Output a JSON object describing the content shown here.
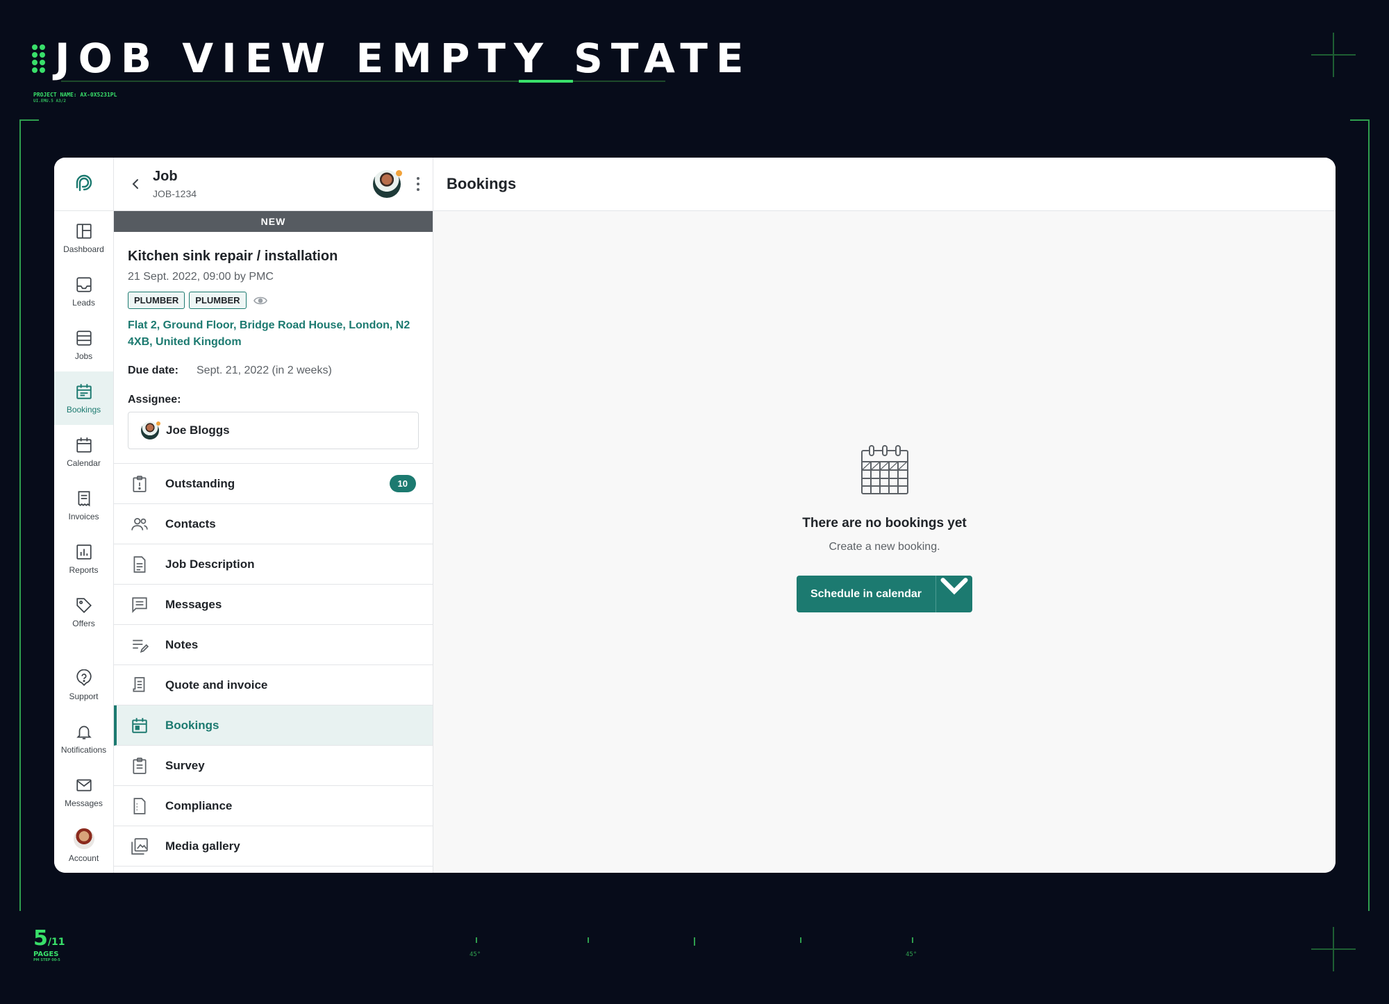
{
  "deck": {
    "title": "JOB VIEW EMPTY STATE",
    "project_name": "PROJECT NAME: AX-0X5231PL",
    "project_sub": "UI.EMU.5 A3/2",
    "page_current": "5",
    "page_total": "/11",
    "page_label": "PAGES",
    "page_sub": "PM STEP 00-5",
    "angle_left": "45°",
    "angle_right": "45°"
  },
  "colors": {
    "accent": "#1c7a70",
    "deck_bg": "#070c1a",
    "deck_green": "#39e06a",
    "status_bar": "#565b61"
  },
  "rail": {
    "logo_icon": "app-logo-icon",
    "items": [
      {
        "label": "Dashboard",
        "icon": "dashboard-icon"
      },
      {
        "label": "Leads",
        "icon": "inbox-icon"
      },
      {
        "label": "Jobs",
        "icon": "jobs-icon"
      },
      {
        "label": "Bookings",
        "icon": "bookings-icon",
        "active": true
      },
      {
        "label": "Calendar",
        "icon": "calendar-icon"
      },
      {
        "label": "Invoices",
        "icon": "invoice-icon"
      },
      {
        "label": "Reports",
        "icon": "reports-icon"
      },
      {
        "label": "Offers",
        "icon": "tag-icon"
      }
    ],
    "bottom": [
      {
        "label": "Support",
        "icon": "help-icon"
      },
      {
        "label": "Notifications",
        "icon": "bell-icon"
      },
      {
        "label": "Messages",
        "icon": "mail-icon"
      },
      {
        "label": "Account",
        "icon": "avatar"
      }
    ]
  },
  "panel": {
    "title": "Job",
    "job_id": "JOB-1234",
    "status": "NEW",
    "job_title": "Kitchen sink repair / installation",
    "job_meta": "21 Sept. 2022, 09:00 by PMC",
    "tags": [
      "PLUMBER",
      "PLUMBER"
    ],
    "address": "Flat 2, Ground Floor, Bridge Road House, London, N2 4XB, United Kingdom",
    "due_label": "Due date:",
    "due_value": "Sept. 21, 2022 (in 2 weeks)",
    "assignee_label": "Assignee:",
    "assignee_name": "Joe Bloggs",
    "menu": [
      {
        "label": "Outstanding",
        "icon": "alert-clipboard-icon",
        "badge": "10"
      },
      {
        "label": "Contacts",
        "icon": "people-icon"
      },
      {
        "label": "Job Description",
        "icon": "document-icon"
      },
      {
        "label": "Messages",
        "icon": "chat-icon"
      },
      {
        "label": "Notes",
        "icon": "notes-icon"
      },
      {
        "label": "Quote and invoice",
        "icon": "receipt-icon"
      },
      {
        "label": "Bookings",
        "icon": "calendar-icon",
        "active": true
      },
      {
        "label": "Survey",
        "icon": "clipboard-icon"
      },
      {
        "label": "Compliance",
        "icon": "compliance-icon"
      },
      {
        "label": "Media gallery",
        "icon": "gallery-icon"
      }
    ]
  },
  "main": {
    "title": "Bookings",
    "empty_title": "There are no bookings yet",
    "empty_sub": "Create a new booking.",
    "cta_label": "Schedule in calendar"
  }
}
